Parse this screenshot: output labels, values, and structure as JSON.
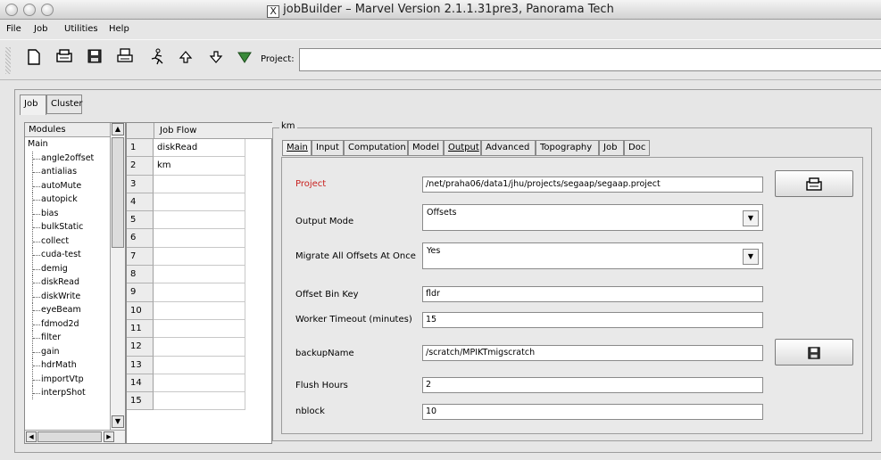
{
  "window": {
    "title": "jobBuilder – Marvel Version 2.1.1.31pre3, Panorama Tech",
    "title_icon": "x11-icon"
  },
  "menu": [
    "File",
    "Job",
    "Utilities",
    "Help"
  ],
  "toolbar": {
    "buttons": [
      "new-document-icon",
      "open-icon",
      "save-icon",
      "print-icon",
      "run-icon",
      "move-up-icon",
      "move-down-icon",
      "filter-icon"
    ],
    "project_label": "Project:",
    "project_value": ""
  },
  "outer_tabs": [
    "Job",
    "Cluster"
  ],
  "modules": {
    "header": "Modules",
    "root": "Main",
    "items": [
      "angle2offset",
      "antialias",
      "autoMute",
      "autopick",
      "bias",
      "bulkStatic",
      "collect",
      "cuda-test",
      "demig",
      "diskRead",
      "diskWrite",
      "eyeBeam",
      "fdmod2d",
      "filter",
      "gain",
      "hdrMath",
      "importVtp",
      "interpShot"
    ]
  },
  "jobflow": {
    "header": "Job Flow",
    "rows": [
      {
        "n": "1",
        "v": "diskRead"
      },
      {
        "n": "2",
        "v": "km"
      },
      {
        "n": "3",
        "v": ""
      },
      {
        "n": "4",
        "v": ""
      },
      {
        "n": "5",
        "v": ""
      },
      {
        "n": "6",
        "v": ""
      },
      {
        "n": "7",
        "v": ""
      },
      {
        "n": "8",
        "v": ""
      },
      {
        "n": "9",
        "v": ""
      },
      {
        "n": "10",
        "v": ""
      },
      {
        "n": "11",
        "v": ""
      },
      {
        "n": "12",
        "v": ""
      },
      {
        "n": "13",
        "v": ""
      },
      {
        "n": "14",
        "v": ""
      },
      {
        "n": "15",
        "v": ""
      }
    ]
  },
  "km": {
    "group_label": "km",
    "tabs": [
      "Main",
      "Input",
      "Computation",
      "Model",
      "Output",
      "Advanced",
      "Topography",
      "Job",
      "Doc"
    ],
    "fields": {
      "project_label": "Project",
      "project_value": "/net/praha06/data1/jhu/projects/segaap/segaap.project",
      "output_mode_label": "Output Mode",
      "output_mode_value": "Offsets",
      "migrate_label": "Migrate All Offsets At Once",
      "migrate_value": "Yes",
      "offset_bin_label": "Offset Bin Key",
      "offset_bin_value": "fldr",
      "worker_timeout_label": "Worker Timeout (minutes)",
      "worker_timeout_value": "15",
      "backup_label": "backupName",
      "backup_value": "/scratch/MPIKTmigscratch",
      "flush_label": "Flush Hours",
      "flush_value": "2",
      "nblock_label": "nblock",
      "nblock_value": "10"
    }
  },
  "colors": {
    "required_label": "#c8201e",
    "background": "#e6e6e6"
  }
}
